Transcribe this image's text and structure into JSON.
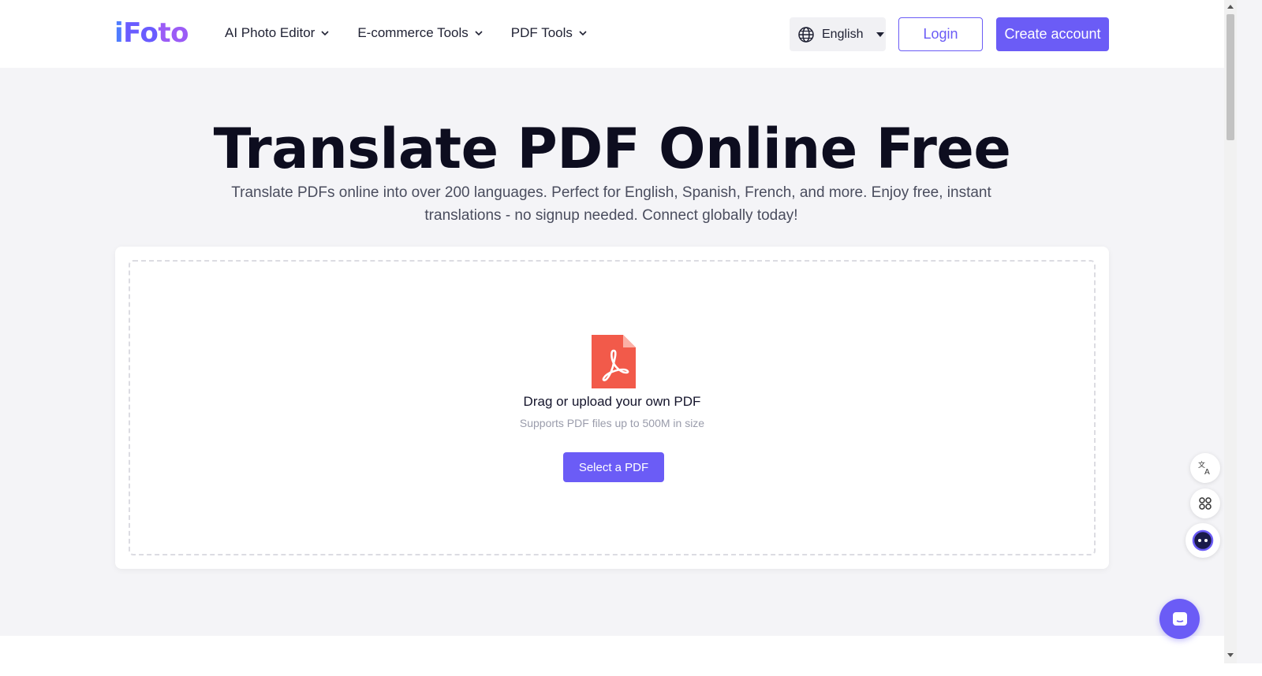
{
  "header": {
    "logo": {
      "p1": "i",
      "p2": "Fo",
      "p3": "to"
    },
    "nav": [
      {
        "label": "AI Photo Editor"
      },
      {
        "label": "E-commerce Tools"
      },
      {
        "label": "PDF Tools"
      }
    ],
    "language": "English",
    "login_label": "Login",
    "create_label": "Create account"
  },
  "hero": {
    "title": "Translate PDF Online Free",
    "subtitle": "Translate PDFs online into over 200 languages. Perfect for English, Spanish, French, and more. Enjoy free, instant translations - no signup needed. Connect globally today!"
  },
  "upload": {
    "drag_text": "Drag or upload your own PDF",
    "support_text": "Supports PDF files up to 500M in size",
    "button_label": "Select a PDF"
  },
  "colors": {
    "accent": "#6b5cf6",
    "pdf_red": "#f25a4a",
    "background": "#f4f4f7"
  },
  "icons": {
    "language": "globe-icon",
    "translate": "translate-icon",
    "apps": "apps-icon",
    "assistant": "assistant-face-icon",
    "chat": "chat-icon"
  }
}
